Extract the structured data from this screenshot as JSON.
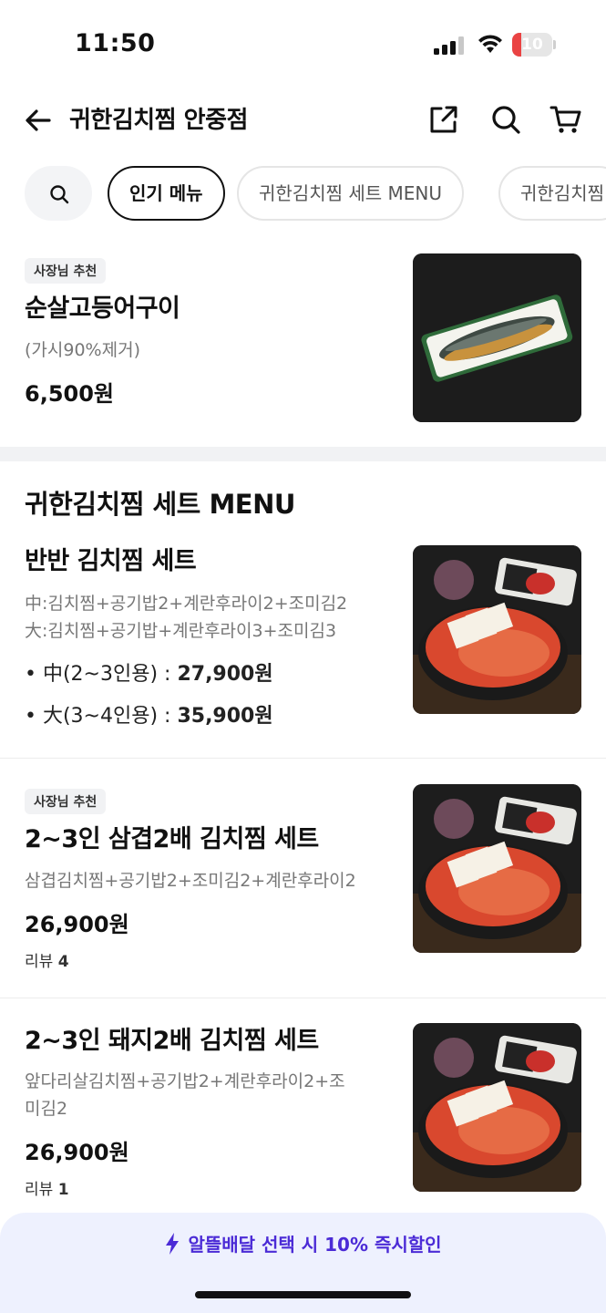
{
  "status_bar": {
    "time": "11:50",
    "battery_level": "10",
    "battery_color": "#ea4343"
  },
  "header": {
    "title": "귀한김치찜 안중점",
    "icons": [
      "back-arrow-icon",
      "share-icon",
      "search-icon",
      "cart-icon"
    ]
  },
  "chips": [
    {
      "label": "인기 메뉴",
      "active": true
    },
    {
      "label": "귀한김치찜  세트 MENU",
      "active": false
    },
    {
      "label": "귀한김치찜",
      "active": false
    }
  ],
  "popular": {
    "badge": "사장님 추천",
    "name": "순살고등어구이",
    "desc": "(가시90%제거)",
    "price": "6,500원"
  },
  "section": {
    "title": "귀한김치찜  세트 MENU"
  },
  "items": [
    {
      "name": "반반 김치찜 세트",
      "desc_line1": "中:김치찜+공기밥2+계란후라이2+조미김2",
      "desc_line2": "大:김치찜+공기밥+계란후라이3+조미김3",
      "options": [
        {
          "label": "• 中(2~3인용) : ",
          "price": "27,900원"
        },
        {
          "label": "• 大(3~4인용) : ",
          "price": "35,900원"
        }
      ]
    },
    {
      "badge": "사장님 추천",
      "name": "2~3인 삼겹2배 김치찜 세트",
      "desc": "삼겹김치찜+공기밥2+조미김2+계란후라이2",
      "price": "26,900원",
      "review_label": "리뷰",
      "review_count": "4"
    },
    {
      "name": "2~3인 돼지2배 김치찜 세트",
      "desc_line1": "앞다리살김치찜+공기밥2+계란후라이2+조",
      "desc_line2": "미김2",
      "price": "26,900원",
      "review_label": "리뷰",
      "review_count": "1"
    }
  ],
  "banner": {
    "text": "알뜰배달 선택 시 10% 즉시할인",
    "color": "#4b2bd6"
  }
}
